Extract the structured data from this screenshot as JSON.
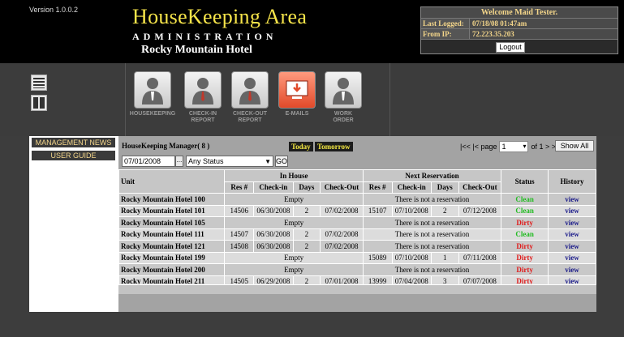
{
  "header": {
    "version": "Version 1.0.0.2",
    "title": "HouseKeeping Area",
    "subtitle": "ADMINISTRATION",
    "hotel": "Rocky Mountain Hotel"
  },
  "welcome": {
    "title": "Welcome Maid Tester.",
    "last_logged_label": "Last Logged:",
    "last_logged_value": "07/18/08 01:47am",
    "from_ip_label": "From IP:",
    "from_ip_value": "72.223.35.203",
    "logout_label": "Logout"
  },
  "nav": {
    "housekeeping": "HOUSEKEEPING",
    "checkin_1": "CHECK-IN",
    "checkin_2": "REPORT",
    "checkout_1": "CHECK-OUT",
    "checkout_2": "REPORT",
    "emails": "E-MAILS",
    "workorder_1": "WORK",
    "workorder_2": "ORDER"
  },
  "sidebar": {
    "management_news": "MANAGEMENT NEWS",
    "user_guide": "USER GUIDE"
  },
  "toolbar": {
    "manager_title": "HouseKeeping Manager( 8 )",
    "today": "Today",
    "tomorrow": "Tomorrow",
    "pager_prev": "|<< |< page",
    "page_value": "1",
    "pager_next": "of 1 > >>|",
    "show_all": "Show All",
    "date_value": "07/01/2008",
    "date_btn": "...",
    "status_value": "Any Status",
    "go": "GO"
  },
  "grid": {
    "headers": {
      "unit": "Unit",
      "in_house": "In House",
      "next_reservation": "Next Reservation",
      "status": "Status",
      "history": "History",
      "res": "Res #",
      "checkin": "Check-in",
      "days": "Days",
      "checkout": "Check-Out"
    },
    "empty_text": "Empty",
    "no_reservation_text": "There is not a reservation",
    "rows": [
      {
        "unit": "Rocky Mountain Hotel 100",
        "ih": null,
        "nr": null,
        "status": "Clean",
        "history": "view"
      },
      {
        "unit": "Rocky Mountain Hotel 101",
        "ih": [
          "14506",
          "06/30/2008",
          "2",
          "07/02/2008"
        ],
        "nr": [
          "15107",
          "07/10/2008",
          "2",
          "07/12/2008"
        ],
        "status": "Clean",
        "history": "view"
      },
      {
        "unit": "Rocky Mountain Hotel 105",
        "ih": null,
        "nr": null,
        "status": "Dirty",
        "history": "view"
      },
      {
        "unit": "Rocky Mountain Hotel 111",
        "ih": [
          "14507",
          "06/30/2008",
          "2",
          "07/02/2008"
        ],
        "nr": null,
        "status": "Clean",
        "history": "view"
      },
      {
        "unit": "Rocky Mountain Hotel 121",
        "ih": [
          "14508",
          "06/30/2008",
          "2",
          "07/02/2008"
        ],
        "nr": null,
        "status": "Dirty",
        "history": "view"
      },
      {
        "unit": "Rocky Mountain Hotel 199",
        "ih": null,
        "nr": [
          "15089",
          "07/10/2008",
          "1",
          "07/11/2008"
        ],
        "status": "Dirty",
        "history": "view"
      },
      {
        "unit": "Rocky Mountain Hotel 200",
        "ih": null,
        "nr": null,
        "status": "Dirty",
        "history": "view"
      },
      {
        "unit": "Rocky Mountain Hotel 211",
        "ih": [
          "14505",
          "06/29/2008",
          "2",
          "07/01/2008"
        ],
        "nr": [
          "13999",
          "07/04/2008",
          "3",
          "07/07/2008"
        ],
        "status": "Dirty",
        "history": "view"
      }
    ]
  },
  "colors": {
    "title": "#f7e54a",
    "clean": "#22bb22",
    "dirty": "#e01b1b",
    "view": "#1b1b8a"
  },
  "icons": {
    "small_icon_1": "list-view-icon",
    "small_icon_2": "column-view-icon",
    "housekeeping": "maid-person-icon",
    "checkin": "person-icon",
    "checkout": "person-icon",
    "emails": "email-inbox-icon",
    "workorder": "worker-person-icon"
  }
}
